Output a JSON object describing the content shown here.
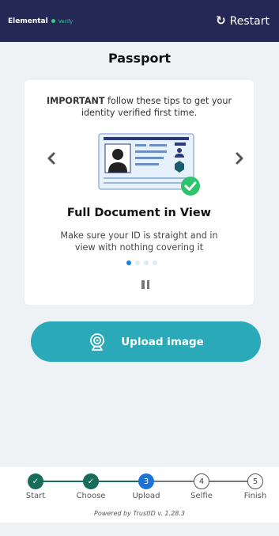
{
  "header": {
    "brand_name": "Elemental",
    "brand_tag": "Verify",
    "restart_icon": "restart-arrow-icon",
    "restart_label": "Restart",
    "background_color": "#232855"
  },
  "page": {
    "title": "Passport"
  },
  "tips_card": {
    "tip_prefix": "IMPORTANT",
    "tip_text": "follow these tips to get your identity verified first time.",
    "heading": "Full Document in View",
    "description": "Make sure your ID is straight and in view with nothing covering it",
    "slides_total": 4,
    "active_slide": 1,
    "prev_icon": "chevron-left-icon",
    "next_icon": "chevron-right-icon",
    "pause_icon": "pause-icon"
  },
  "upload": {
    "label": "Upload image",
    "icon": "webcam-icon",
    "color": "#2aa9b8"
  },
  "stepper": {
    "steps": [
      {
        "label": "Start",
        "number": "1",
        "state": "done"
      },
      {
        "label": "Choose",
        "number": "2",
        "state": "done"
      },
      {
        "label": "Upload",
        "number": "3",
        "state": "current"
      },
      {
        "label": "Selfie",
        "number": "4",
        "state": "todo"
      },
      {
        "label": "Finish",
        "number": "5",
        "state": "todo"
      }
    ],
    "done_color": "#176c5a",
    "current_color": "#1c73d6"
  },
  "footer": {
    "powered_by": "Powered by TrustID v. 1.28.3"
  }
}
